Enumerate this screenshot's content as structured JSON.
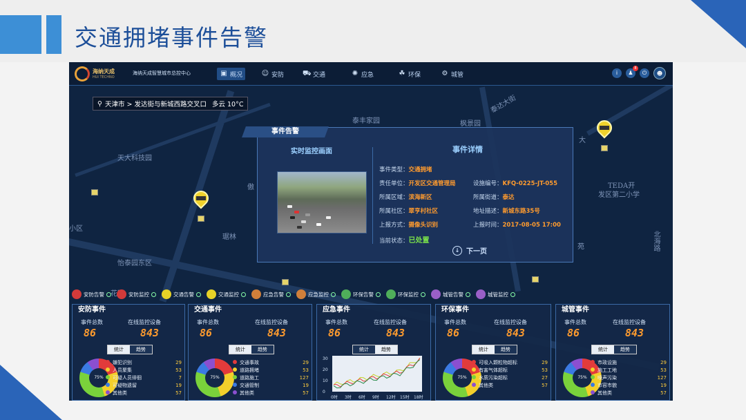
{
  "slide": {
    "title": "交通拥堵事件告警"
  },
  "topbar": {
    "brand_name": "海纳天成",
    "brand_sub": "HUI TECHNO",
    "org_name": "海纳天成智慧城市总控中心",
    "nav": [
      {
        "label": "概况",
        "icon": "overview-icon",
        "active": true
      },
      {
        "label": "安防",
        "icon": "security-icon",
        "active": false
      },
      {
        "label": "交通",
        "icon": "car-icon",
        "active": false
      },
      {
        "label": "应急",
        "icon": "emergency-icon",
        "active": false
      },
      {
        "label": "环保",
        "icon": "leaf-icon",
        "active": false
      },
      {
        "label": "城管",
        "icon": "gear-icon",
        "active": false
      }
    ],
    "badge": "8"
  },
  "location": {
    "text": "天津市 > 发达街与新城西路交叉口",
    "weather": "多云 10°C"
  },
  "map_labels": [
    "泰丰家园",
    "枫景园",
    "天大科技园",
    "傲",
    "TEDA开",
    "发区第二小学",
    "小区",
    "琚林",
    "怡泰园东区",
    "大",
    "泰达大街",
    "北海路",
    "苑",
    "花园"
  ],
  "popup": {
    "tab": "事件告警",
    "live_title": "实时监控画面",
    "detail_title": "事件详情",
    "rows": [
      {
        "label": "事件类型：",
        "value": "交通拥堵"
      },
      {
        "label": "责任单位：",
        "value": "开发区交通管理局",
        "label2": "设施编号：",
        "value2": "KFQ-0225-JT-055"
      },
      {
        "label": "所属区域：",
        "value": "滨海新区",
        "label2": "所属街道：",
        "value2": "泰达"
      },
      {
        "label": "所属社区：",
        "value": "翠亨村社区",
        "label2": "地址描述：",
        "value2": "新城东路35号"
      },
      {
        "label": "上报方式：",
        "value": "摄像头识别",
        "label2": "上报时间：",
        "value2": "2017-08-05 17:00"
      },
      {
        "label": "当前状态：",
        "value": "已处置"
      }
    ],
    "next": "下一页"
  },
  "legend": [
    {
      "label": "安防告警",
      "color": "#d23a3a"
    },
    {
      "label": "安防监控",
      "color": "#d23a3a"
    },
    {
      "label": "交通告警",
      "color": "#e7d227"
    },
    {
      "label": "交通监控",
      "color": "#e7d227"
    },
    {
      "label": "应急告警",
      "color": "#d07f3a"
    },
    {
      "label": "应急监控",
      "color": "#d07f3a"
    },
    {
      "label": "环保告警",
      "color": "#4fae5a"
    },
    {
      "label": "环保监控",
      "color": "#4fae5a"
    },
    {
      "label": "城管告警",
      "color": "#9a5fc7"
    },
    {
      "label": "城管监控",
      "color": "#9a5fc7"
    }
  ],
  "panels": [
    {
      "title": "安防事件",
      "total_label": "事件总数",
      "online_label": "在线监控设备",
      "total": "86",
      "online": "843",
      "tabs": [
        "统计",
        "趋势"
      ],
      "items": [
        {
          "label": "嫌犯识别",
          "value": "29",
          "color": "#e23b3b"
        },
        {
          "label": "人员聚集",
          "value": "53",
          "color": "#f3cf2b"
        },
        {
          "label": "可疑人员徘徊",
          "value": "7",
          "color": "#7ad23b"
        },
        {
          "label": "可疑物遗留",
          "value": "19",
          "color": "#3b7ae2"
        },
        {
          "label": "其他类",
          "value": "57",
          "color": "#8b4fd0"
        }
      ]
    },
    {
      "title": "交通事件",
      "total_label": "事件总数",
      "online_label": "在线监控设备",
      "total": "86",
      "online": "843",
      "tabs": [
        "统计",
        "趋势"
      ],
      "items": [
        {
          "label": "交通事故",
          "value": "29",
          "color": "#e23b3b"
        },
        {
          "label": "道路拥堵",
          "value": "53",
          "color": "#f3cf2b"
        },
        {
          "label": "道路施工",
          "value": "127",
          "color": "#7ad23b"
        },
        {
          "label": "交通管制",
          "value": "19",
          "color": "#3b7ae2"
        },
        {
          "label": "其他类",
          "value": "57",
          "color": "#8b4fd0"
        }
      ]
    },
    {
      "title": "应急事件",
      "total_label": "事件总数",
      "online_label": "在线监控设备",
      "total": "86",
      "online": "843",
      "tabs": [
        "统计",
        "趋势"
      ],
      "items": []
    },
    {
      "title": "环保事件",
      "total_label": "事件总数",
      "online_label": "在线监控设备",
      "total": "86",
      "online": "843",
      "tabs": [
        "统计",
        "趋势"
      ],
      "items": [
        {
          "label": "可吸入颗粒物超标",
          "value": "29",
          "color": "#e23b3b"
        },
        {
          "label": "有害气体超标",
          "value": "53",
          "color": "#f3cf2b"
        },
        {
          "label": "水质污染超标",
          "value": "27",
          "color": "#7ad23b"
        },
        {
          "label": "其他类",
          "value": "57",
          "color": "#8b4fd0"
        }
      ]
    },
    {
      "title": "城管事件",
      "total_label": "事件总数",
      "online_label": "在线监控设备",
      "total": "86",
      "online": "843",
      "tabs": [
        "统计",
        "趋势"
      ],
      "items": [
        {
          "label": "市政设施",
          "value": "29",
          "color": "#e23b3b"
        },
        {
          "label": "施工工地",
          "value": "53",
          "color": "#f3cf2b"
        },
        {
          "label": "噪声污染",
          "value": "127",
          "color": "#7ad23b"
        },
        {
          "label": "市容市貌",
          "value": "19",
          "color": "#3b7ae2"
        },
        {
          "label": "其他类",
          "value": "57",
          "color": "#8b4fd0"
        }
      ]
    }
  ],
  "trend_chart": {
    "y_ticks": [
      "30",
      "20",
      "10",
      "0"
    ],
    "x_ticks": [
      "0时",
      "3时",
      "6时",
      "9时",
      "12时",
      "15时",
      "18时"
    ]
  },
  "donut_center": {
    "top": "25%",
    "bottom": "75%"
  }
}
